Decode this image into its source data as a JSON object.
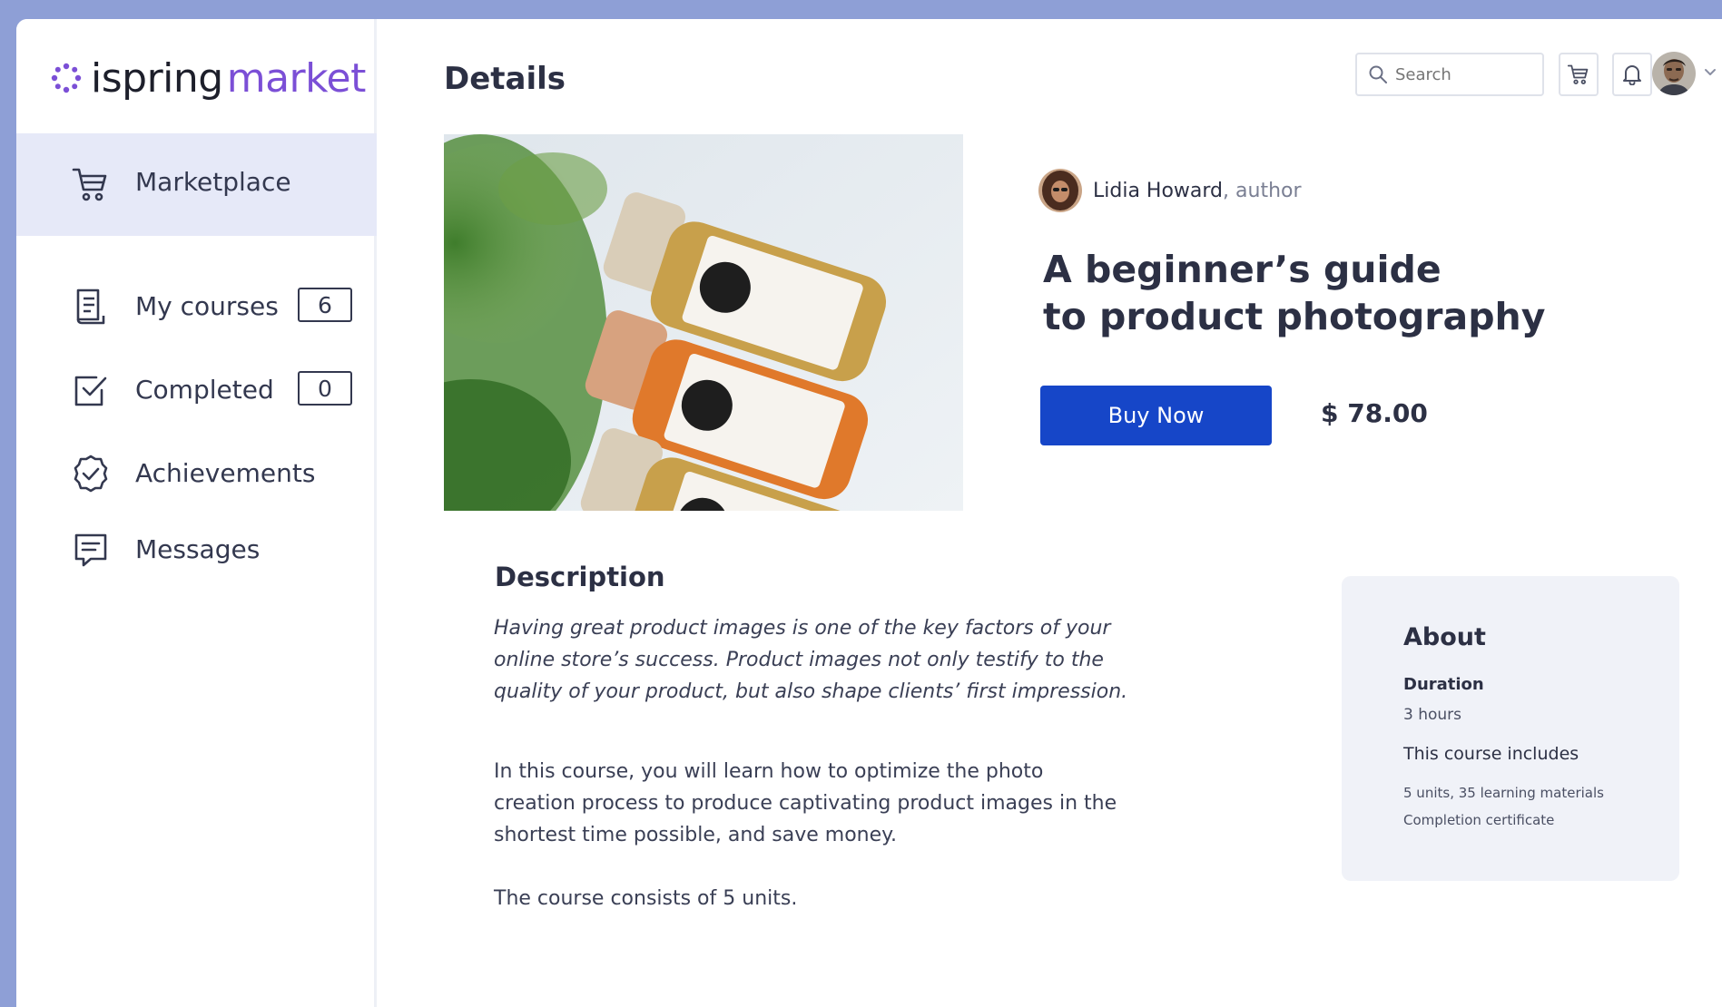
{
  "brand": {
    "name_part1": "ispring",
    "name_part2": "market"
  },
  "sidebar": {
    "items": [
      {
        "label": "Marketplace",
        "icon": "cart-icon",
        "active": true
      },
      {
        "label": "My courses",
        "icon": "courses-icon",
        "count": "6"
      },
      {
        "label": "Completed",
        "icon": "completed-check-icon",
        "count": "0"
      },
      {
        "label": "Achievements",
        "icon": "achievement-badge-icon"
      },
      {
        "label": "Messages",
        "icon": "messages-icon"
      }
    ]
  },
  "header": {
    "title": "Details",
    "search_placeholder": "Search"
  },
  "course": {
    "author_name": "Lidia Howard",
    "author_role": ", author",
    "title_line1": "A beginner’s guide",
    "title_line2": "to product photography",
    "buy_label": "Buy Now",
    "price": "$ 78.00"
  },
  "description": {
    "heading": "Description",
    "intro_line1": "Having great product images is one of the key factors of your",
    "intro_line2": "online store’s success. Product images not only testify to the",
    "intro_line3": "quality of your product, but also shape clients’ first impression.",
    "p2_line1": "In this course, you will learn how to optimize the photo",
    "p2_line2": "creation process to produce captivating product images in the",
    "p2_line3": "shortest time possible, and save money.",
    "p3": "The course consists of 5 units."
  },
  "about": {
    "title": "About",
    "duration_label": "Duration",
    "duration_value": "3 hours",
    "includes_label": "This course includes",
    "includes_line1": "5 units, 35 learning materials",
    "includes_line2": "Completion certificate"
  },
  "colors": {
    "accent": "#1646c8",
    "brand_purple": "#7b4fd6",
    "active_nav_bg": "#e6e9f8",
    "page_bg": "#8e9fd6"
  }
}
